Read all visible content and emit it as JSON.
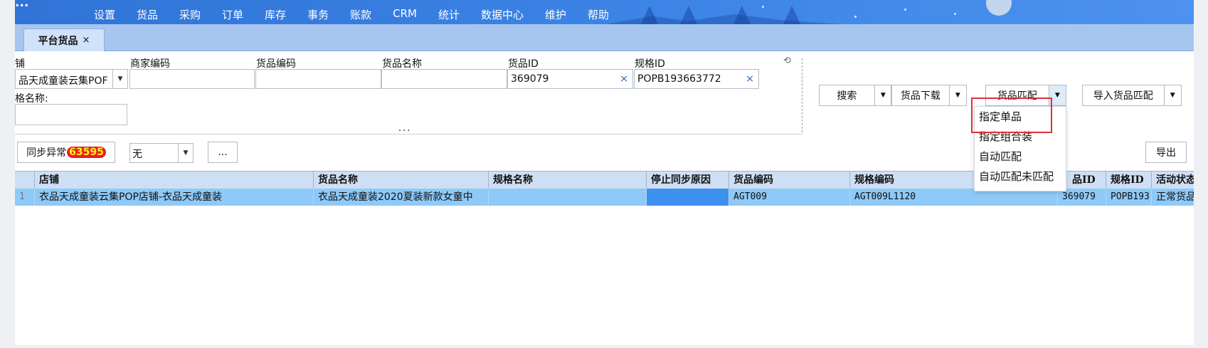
{
  "menubar": {
    "logo": "...",
    "items": [
      "设置",
      "货品",
      "采购",
      "订单",
      "库存",
      "事务",
      "账款",
      "CRM",
      "统计",
      "数据中心",
      "维护",
      "帮助"
    ]
  },
  "tabs": [
    {
      "label": "平台货品",
      "close": "×"
    }
  ],
  "filters": {
    "shop_label": "铺",
    "shop_value": "品天成童装云集POF",
    "merchant_code_label": "商家编码",
    "goods_code_label": "货品编码",
    "goods_name_label": "货品名称",
    "goods_id_label": "货品ID",
    "goods_id_value": "369079",
    "spec_id_label": "规格ID",
    "spec_id_value": "POPB193663772",
    "spec_name_label": "格名称:",
    "clear": "×",
    "collapse": "...",
    "refresh": "⟲"
  },
  "actions": {
    "search": "搜索",
    "download": "货品下载",
    "match": "货品匹配",
    "import_match": "导入货品匹配",
    "export": "导出"
  },
  "dropdown": {
    "items": [
      "指定单品",
      "指定组合装",
      "自动匹配",
      "自动匹配未匹配"
    ]
  },
  "toolbar": {
    "sync_error_label": "同步异常",
    "sync_error_count": "63595",
    "filter_value": "无",
    "more": "..."
  },
  "grid": {
    "columns": [
      "店铺",
      "货品名称",
      "规格名称",
      "停止同步原因",
      "货品编码",
      "规格编码",
      "品ID",
      "规格ID",
      "活动状态"
    ],
    "rows": [
      {
        "num": "1",
        "shop": "衣品天成童装云集POP店铺-衣品天成童装",
        "goods_name": "衣品天成童装2020夏装新款女童中",
        "spec_name": "",
        "stop_reason": "",
        "goods_code": "AGT009",
        "spec_code": "AGT009L1120",
        "goods_id": "369079",
        "spec_id": "POPB193",
        "status": "正常货品"
      }
    ]
  },
  "colors": {
    "menubar": "#3c84e6",
    "tabbar": "#a6c6ef",
    "selected_row": "#8ec9f8",
    "highlight_box": "#e0303a",
    "badge_bg": "#e8201c",
    "badge_text": "#ffee22"
  }
}
